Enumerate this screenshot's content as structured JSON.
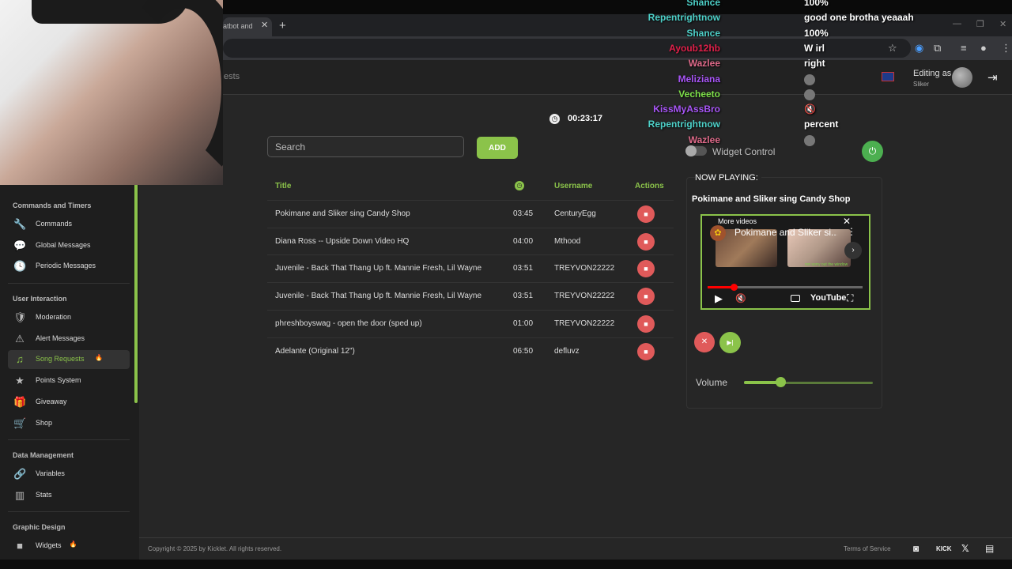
{
  "browser": {
    "tab_title": "atbot and",
    "tab_close": "✕",
    "new_tab": "+",
    "window_controls": [
      "—",
      "❐",
      "✕"
    ]
  },
  "header": {
    "breadcrumb": "ests",
    "editing_as_label": "Editing as",
    "editing_as_user": "Sliker"
  },
  "sidebar": {
    "sections": [
      {
        "title": "Commands and Timers",
        "items": [
          {
            "label": "Commands",
            "icon": "wrench-icon",
            "glyph": "🔧"
          },
          {
            "label": "Global Messages",
            "icon": "chat-bubble-icon",
            "glyph": "💬"
          },
          {
            "label": "Periodic Messages",
            "icon": "clock-icon",
            "glyph": "🕓"
          }
        ]
      },
      {
        "title": "User Interaction",
        "items": [
          {
            "label": "Moderation",
            "icon": "shield-icon",
            "glyph": "🛡"
          },
          {
            "label": "Alert Messages",
            "icon": "warning-icon",
            "glyph": "⚠"
          },
          {
            "label": "Song Requests",
            "icon": "music-note-icon",
            "glyph": "♫",
            "badge": "🔥",
            "active": true
          },
          {
            "label": "Points System",
            "icon": "star-icon",
            "glyph": "★"
          },
          {
            "label": "Giveaway",
            "icon": "gift-icon",
            "glyph": "🎁"
          },
          {
            "label": "Shop",
            "icon": "cart-icon",
            "glyph": "🛒"
          }
        ]
      },
      {
        "title": "Data Management",
        "items": [
          {
            "label": "Variables",
            "icon": "link-icon",
            "glyph": "🔗"
          },
          {
            "label": "Stats",
            "icon": "bar-chart-icon",
            "glyph": "▥"
          }
        ]
      },
      {
        "title": "Graphic Design",
        "items": [
          {
            "label": "Widgets",
            "icon": "video-camera-icon",
            "glyph": "■",
            "badge": "🔥"
          }
        ]
      }
    ]
  },
  "timer": "00:23:17",
  "search": {
    "placeholder": "Search"
  },
  "add_label": "ADD",
  "table": {
    "headers": {
      "title": "Title",
      "username": "Username",
      "actions": "Actions"
    },
    "rows": [
      {
        "title": "Pokimane and Sliker sing Candy Shop",
        "duration": "03:45",
        "username": "CenturyEgg"
      },
      {
        "title": "Diana Ross -- Upside Down Video HQ",
        "duration": "04:00",
        "username": "Mthood"
      },
      {
        "title": "Juvenile - Back That Thang Up ft. Mannie Fresh, Lil Wayne",
        "duration": "03:51",
        "username": "TREYVON22222"
      },
      {
        "title": "Juvenile - Back That Thang Up ft. Mannie Fresh, Lil Wayne",
        "duration": "03:51",
        "username": "TREYVON22222"
      },
      {
        "title": "phreshboyswag - open the door (sped up)",
        "duration": "01:00",
        "username": "TREYVON22222"
      },
      {
        "title": "Adelante (Original 12\")",
        "duration": "06:50",
        "username": "defluvz"
      }
    ]
  },
  "widget_control": {
    "label": "Widget Control",
    "enabled": false
  },
  "now_playing": {
    "heading": "NOW PLAYING:",
    "title": "Pokimane and Sliker sing Candy Shop",
    "player": {
      "more_videos": "More videos",
      "video_title": "Pokimane and Sliker si...",
      "caption": "not sorry out the window",
      "brand": "YouTube",
      "progress": 0.17
    },
    "volume_label": "Volume",
    "volume": 0.28
  },
  "footer": {
    "copyright": "Copyright © 2025 by Kicklet. All rights reserved.",
    "terms": "Terms of Service",
    "kick": "KICK"
  },
  "chat": [
    {
      "name": "Shance",
      "color": "#4dd0c8",
      "message": "100%"
    },
    {
      "name": "Repentrightnow",
      "color": "#4dd0c8",
      "message": "good one brotha yeaaah"
    },
    {
      "name": "Shance",
      "color": "#4dd0c8",
      "message": "100%"
    },
    {
      "name": "Ayoub12hb",
      "color": "#e0204a",
      "message": "W irl"
    },
    {
      "name": "Wazlee",
      "color": "#e06a8a",
      "message": "right"
    },
    {
      "name": "Meliziana",
      "color": "#a855f7",
      "message": "",
      "emote": true
    },
    {
      "name": "Vecheeto",
      "color": "#7ee04a",
      "message": "",
      "emote": true
    },
    {
      "name": "KissMyAssBro",
      "color": "#a855f7",
      "message": "🔇"
    },
    {
      "name": "Repentrightnow",
      "color": "#4dd0c8",
      "message": "percent"
    },
    {
      "name": "Wazlee",
      "color": "#e06a8a",
      "message": "",
      "emote": true
    }
  ]
}
